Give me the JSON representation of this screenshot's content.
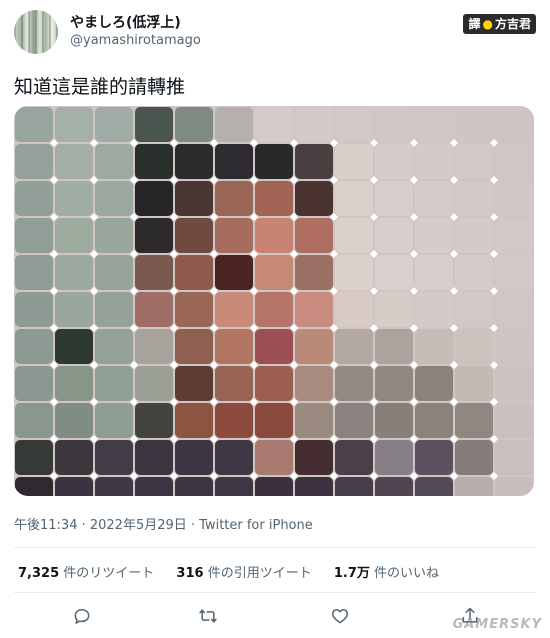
{
  "user": {
    "display_name": "やましろ(低浮上)",
    "handle": "@yamashirotamago"
  },
  "badge": {
    "prefix": "譯",
    "dot": "●",
    "name": "方吉君"
  },
  "tweet": {
    "text": "知道這是誰的請轉推",
    "meta": "午後11:34 · 2022年5月29日 · Twitter for iPhone"
  },
  "stats": {
    "retweets_count": "7,325",
    "retweets_label": "件のリツイート",
    "quotes_count": "316",
    "quotes_label": "件の引用ツイート",
    "likes_count": "1.7万",
    "likes_label": "件のいいね"
  },
  "actions": {
    "icons": [
      "reply-icon",
      "retweet-icon",
      "like-icon",
      "share-icon"
    ],
    "icon_color": "#536471"
  },
  "watermark": "GAMERSKY",
  "mosaic": {
    "columns": 13,
    "rows": 10,
    "cells": [
      [
        "#98a59e",
        "#a4b0a8",
        "#a0aca5",
        "#4a5550",
        "#7f8a83",
        "#b5b0ad",
        "#d5ccc9",
        "#d3cac7",
        "#d2c9c6",
        "#d1c8c5",
        "#d0c7c4",
        "#cfc6c3",
        "#cec5c2"
      ],
      [
        "#95a29b",
        "#a2aea6",
        "#9caa9f",
        "#29302c",
        "#2b2a2d",
        "#2d2b2f",
        "#2a282b",
        "#4a3f40",
        "#d8cfcb",
        "#d6cdca",
        "#d4cbc8",
        "#d2c9c6",
        "#d0c7c4"
      ],
      [
        "#93a099",
        "#a0ada4",
        "#9aa89d",
        "#262628",
        "#4a3734",
        "#9b6556",
        "#a26454",
        "#4a3331",
        "#d9d0cc",
        "#d7cecb",
        "#d5ccc9",
        "#d3cac7",
        "#d1c8c5"
      ],
      [
        "#919e97",
        "#9eab9f",
        "#98a69b",
        "#2d2a2c",
        "#6e4a3f",
        "#a66d5f",
        "#c98372",
        "#b06e62",
        "#dad1cd",
        "#d8cfcc",
        "#d6cdca",
        "#d4cbc8",
        "#d2c9c6"
      ],
      [
        "#909d96",
        "#9ca99e",
        "#96a49a",
        "#7a5a50",
        "#8f5a4c",
        "#4a2423",
        "#c68a74",
        "#9a7064",
        "#dbd2ce",
        "#d9d0cd",
        "#d7cecb",
        "#d5ccc9",
        "#d3cac7"
      ],
      [
        "#8e9b94",
        "#9aa79c",
        "#94a298",
        "#a06e66",
        "#9a6656",
        "#c98a7a",
        "#b47468",
        "#c98a80",
        "#d8cbc6",
        "#d6cdc9",
        "#d4cbc8",
        "#d2c9c6",
        "#d0c7c4"
      ],
      [
        "#8d9a93",
        "#2e3a30",
        "#93a196",
        "#a8a29c",
        "#8f5f50",
        "#b27561",
        "#9c4f55",
        "#b98a78",
        "#b3a8a2",
        "#aba39d",
        "#c4bcb6",
        "#ccc3bf",
        "#cec5c2"
      ],
      [
        "#8b9891",
        "#88968a",
        "#91a094",
        "#9aa096",
        "#5e3c33",
        "#9a6455",
        "#9e5e4f",
        "#a88a7f",
        "#938a85",
        "#908883",
        "#8c837e",
        "#c2bbb5",
        "#ccc3c0"
      ],
      [
        "#8a978f",
        "#7f8d82",
        "#8f9e92",
        "#434440",
        "#8e5442",
        "#8c4b3c",
        "#8a4a3e",
        "#9a8a80",
        "#8a827e",
        "#878078",
        "#8a827c",
        "#8e8782",
        "#cac1be"
      ],
      [
        "#353a36",
        "#3c373d",
        "#413c46",
        "#3b3540",
        "#3e3644",
        "#3f3745",
        "#a87a70",
        "#452d32",
        "#4b4048",
        "#877f88",
        "#5a5060",
        "#847c7a",
        "#c9c0bd"
      ]
    ],
    "bottom_row": [
      "#2e2a30",
      "#3a3440",
      "#3f3847",
      "#3c3644",
      "#3d3645",
      "#3e3746",
      "#3a3040",
      "#3b3140",
      "#463e48",
      "#4f4652",
      "#524a55",
      "#b6aeab",
      "#c8bfbc"
    ]
  }
}
